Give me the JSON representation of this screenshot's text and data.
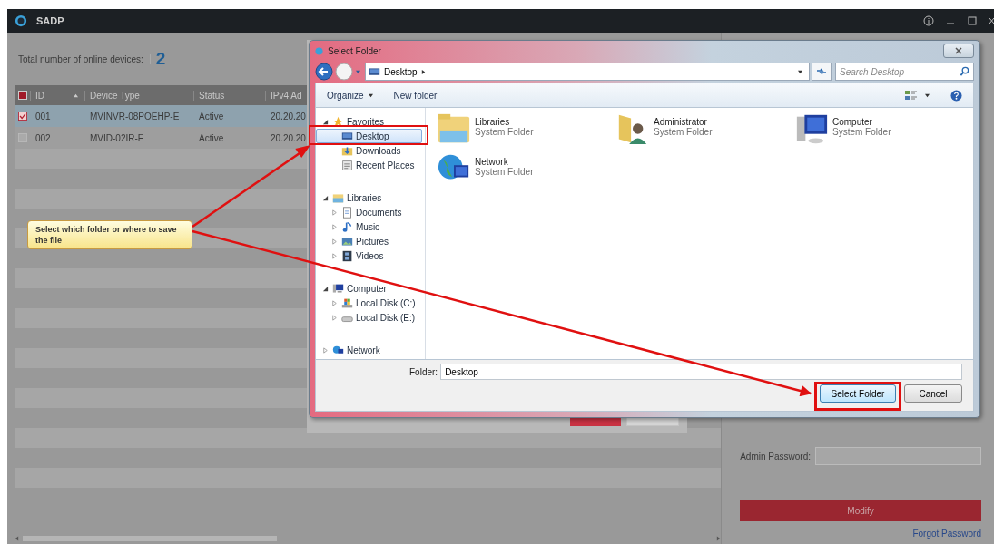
{
  "app": {
    "title": "SADP"
  },
  "summary": {
    "label": "Total number of online devices:",
    "count": "2"
  },
  "table": {
    "header_checked": true,
    "columns": [
      "ID",
      "Device Type",
      "Status",
      "IPv4 Ad"
    ],
    "rows": [
      {
        "checked": true,
        "selected": true,
        "id": "001",
        "device_type": "MVINVR-08POEHP-E",
        "status": "Active",
        "ipv4": "20.20.20"
      },
      {
        "checked": false,
        "selected": false,
        "id": "002",
        "device_type": "MVID-02IR-E",
        "status": "Active",
        "ipv4": "20.20.20"
      }
    ]
  },
  "side_panel": {
    "password_label": "Admin Password:",
    "modify_button": "Modify",
    "forgot_link": "Forgot Password"
  },
  "dialog": {
    "title": "Select Folder",
    "breadcrumb": "Desktop",
    "search_placeholder": "Search Desktop",
    "toolbar": [
      "Organize",
      "New folder"
    ],
    "tree": [
      {
        "label": "Favorites",
        "kind": "favorites",
        "expanded": true,
        "selected": false,
        "children": [
          {
            "label": "Desktop",
            "kind": "desktop",
            "selected": true
          },
          {
            "label": "Downloads",
            "kind": "downloads",
            "selected": false
          },
          {
            "label": "Recent Places",
            "kind": "recent",
            "selected": false
          }
        ]
      },
      {
        "label": "Libraries",
        "kind": "library",
        "expanded": true,
        "selected": false,
        "children": [
          {
            "label": "Documents",
            "kind": "documents",
            "expanded": false,
            "selected": false
          },
          {
            "label": "Music",
            "kind": "music",
            "expanded": false,
            "selected": false
          },
          {
            "label": "Pictures",
            "kind": "pictures",
            "expanded": false,
            "selected": false
          },
          {
            "label": "Videos",
            "kind": "videos",
            "expanded": false,
            "selected": false
          }
        ]
      },
      {
        "label": "Computer",
        "kind": "computer",
        "expanded": true,
        "selected": false,
        "children": [
          {
            "label": "Local Disk (C:)",
            "kind": "system-drive",
            "expanded": false,
            "selected": false
          },
          {
            "label": "Local Disk (E:)",
            "kind": "drive",
            "expanded": false,
            "selected": false
          }
        ]
      },
      {
        "label": "Network",
        "kind": "network",
        "expanded": false,
        "selected": false
      }
    ],
    "items": [
      {
        "name": "Libraries",
        "type": "System Folder",
        "kind": "library"
      },
      {
        "name": "Administrator",
        "type": "System Folder",
        "kind": "user-folder"
      },
      {
        "name": "Computer",
        "type": "System Folder",
        "kind": "computer"
      },
      {
        "name": "Network",
        "type": "System Folder",
        "kind": "network"
      }
    ],
    "folder_label": "Folder:",
    "folder_value": "Desktop",
    "buttons": [
      {
        "label": "Select Folder",
        "kind": "primary"
      },
      {
        "label": "Cancel",
        "kind": "secondary"
      }
    ]
  },
  "annotation": {
    "text": "Select which folder or where to save the file"
  }
}
